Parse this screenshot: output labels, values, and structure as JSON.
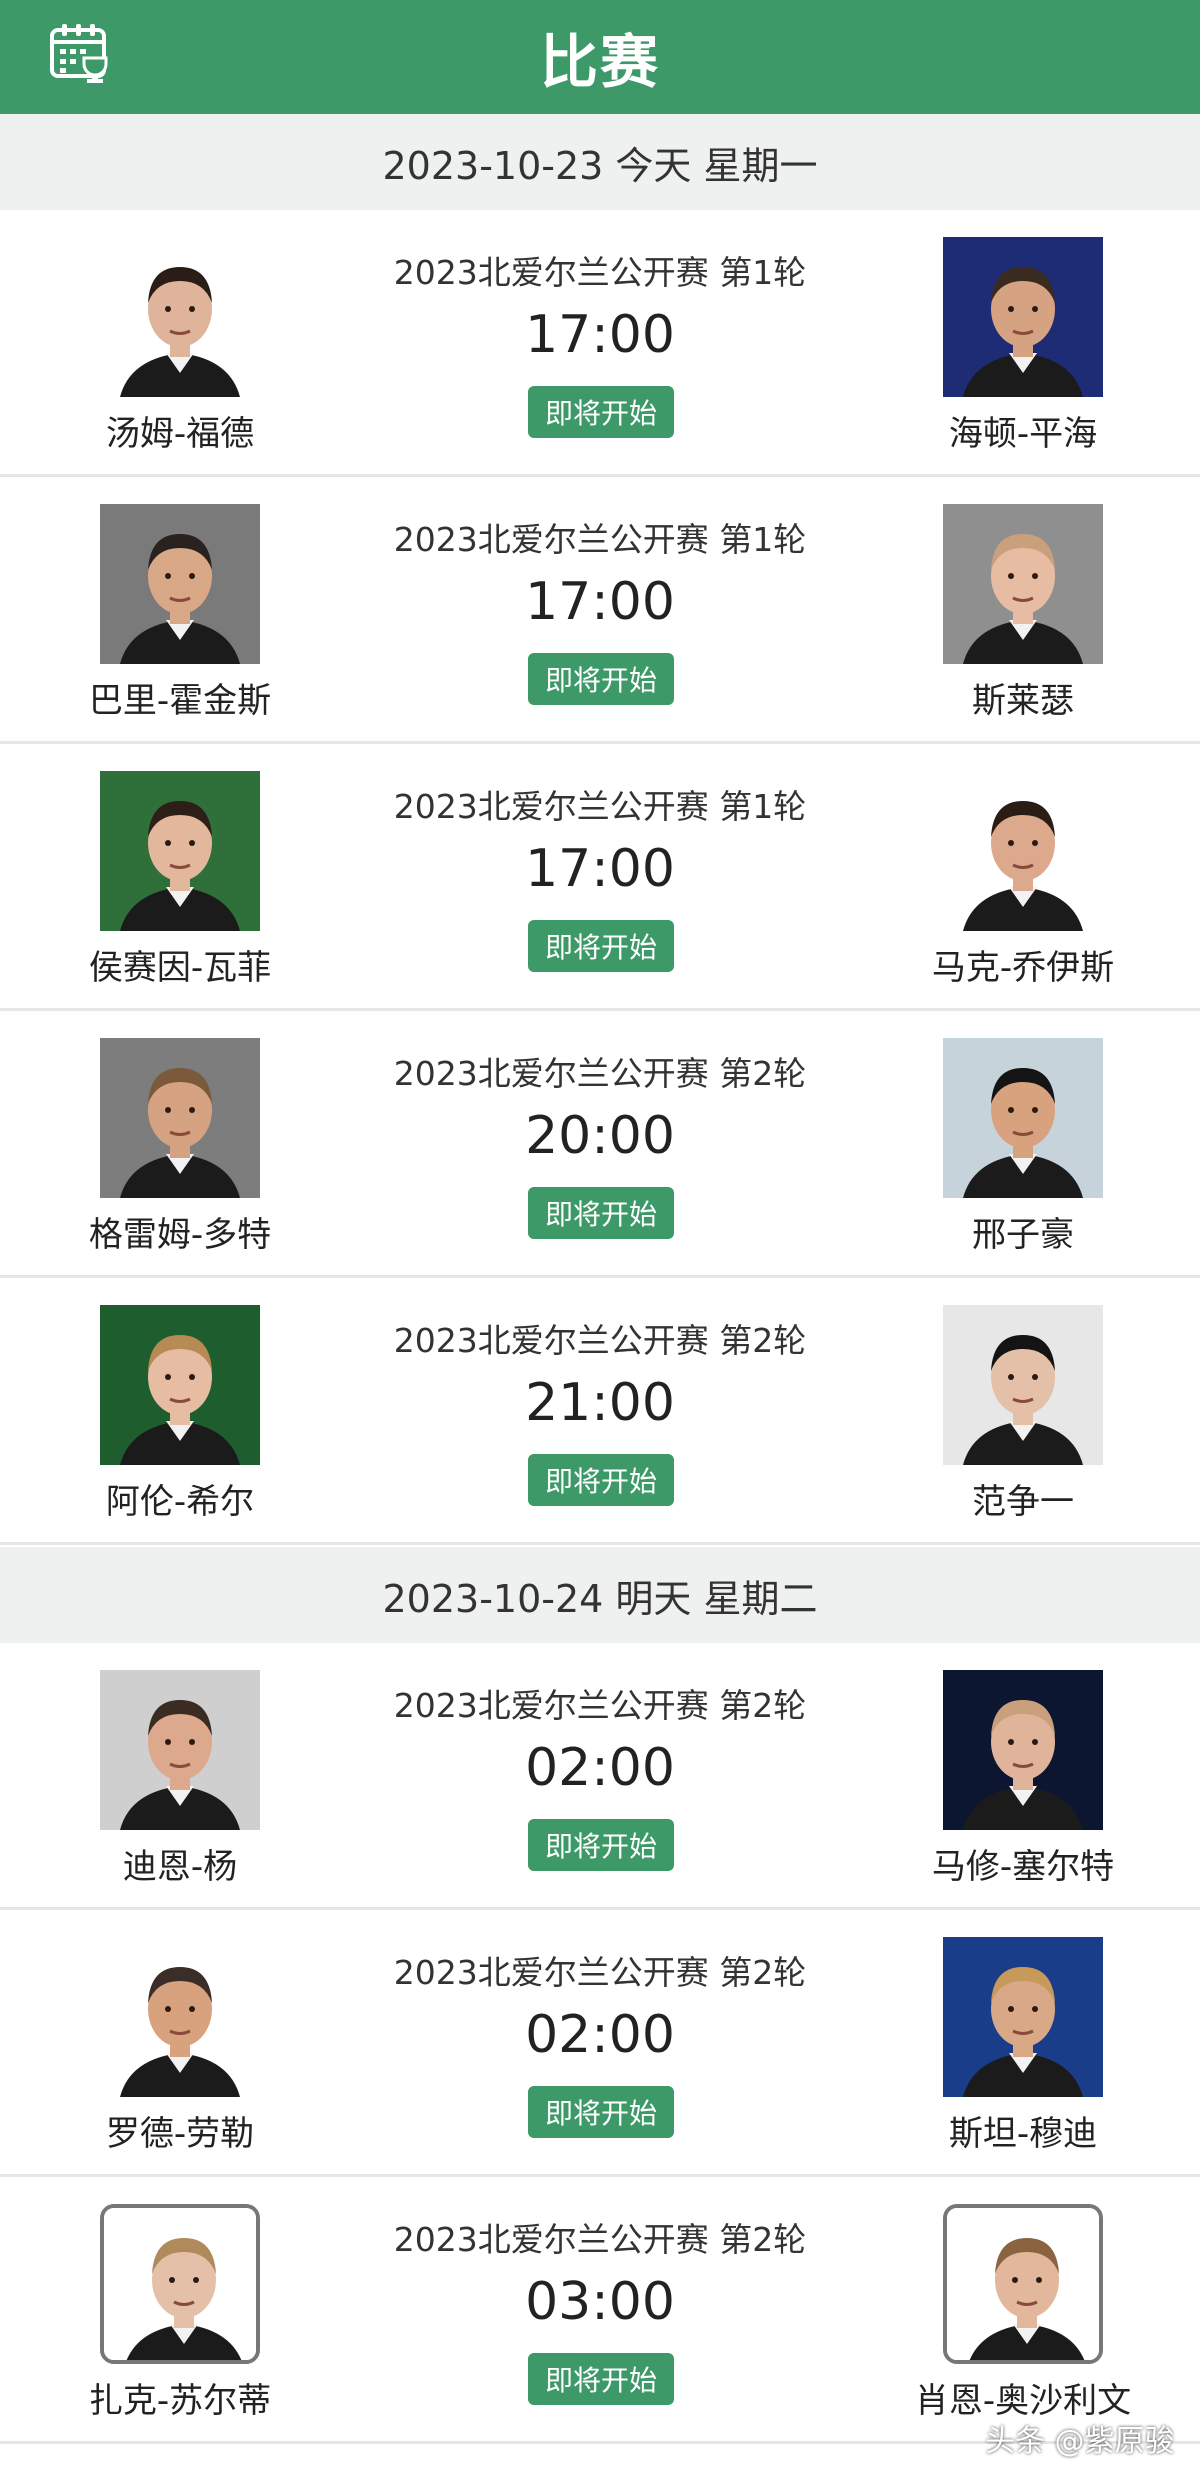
{
  "header": {
    "title": "比赛",
    "icon": "calendar-trophy-icon",
    "color": "#3d9a68"
  },
  "days": [
    {
      "label": "2023-10-23 今天 星期一"
    },
    {
      "label": "2023-10-24 明天 星期二"
    }
  ],
  "matches": [
    {
      "tournament": "2023北爱尔兰公开赛 第1轮",
      "time": "17:00",
      "status": "即将开始",
      "left_player": "汤姆-福德",
      "right_player": "海顿-平海"
    },
    {
      "tournament": "2023北爱尔兰公开赛 第1轮",
      "time": "17:00",
      "status": "即将开始",
      "left_player": "巴里-霍金斯",
      "right_player": "斯莱瑟"
    },
    {
      "tournament": "2023北爱尔兰公开赛 第1轮",
      "time": "17:00",
      "status": "即将开始",
      "left_player": "侯赛因-瓦菲",
      "right_player": "马克-乔伊斯"
    },
    {
      "tournament": "2023北爱尔兰公开赛 第2轮",
      "time": "20:00",
      "status": "即将开始",
      "left_player": "格雷姆-多特",
      "right_player": "邢子豪"
    },
    {
      "tournament": "2023北爱尔兰公开赛 第2轮",
      "time": "21:00",
      "status": "即将开始",
      "left_player": "阿伦-希尔",
      "right_player": "范争一"
    },
    {
      "tournament": "2023北爱尔兰公开赛 第2轮",
      "time": "02:00",
      "status": "即将开始",
      "left_player": "迪恩-杨",
      "right_player": "马修-塞尔特"
    },
    {
      "tournament": "2023北爱尔兰公开赛 第2轮",
      "time": "02:00",
      "status": "即将开始",
      "left_player": "罗德-劳勒",
      "right_player": "斯坦-穆迪"
    },
    {
      "tournament": "2023北爱尔兰公开赛 第2轮",
      "time": "03:00",
      "status": "即将开始",
      "left_player": "扎克-苏尔蒂",
      "right_player": "肖恩-奥沙利文"
    }
  ],
  "watermark": "头条 @紫原骏"
}
